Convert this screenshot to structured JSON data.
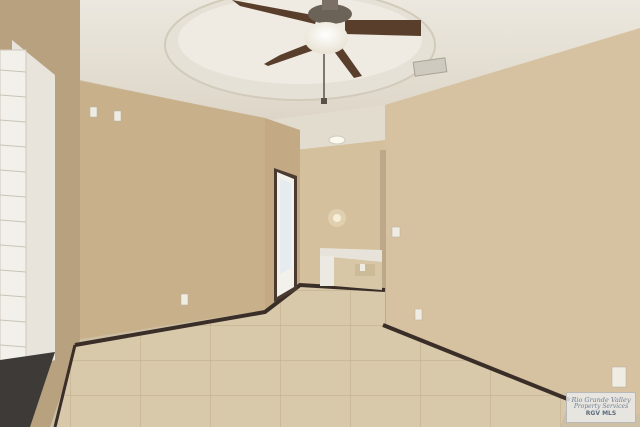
{
  "scene": {
    "description_type": "photo",
    "colors": {
      "wall_left": "#c9b18c",
      "wall_back": "#d6c3a1",
      "wall_right": "#d8c5a2",
      "ceiling": "#e9e4da",
      "floor_tile": "#d8c8aa",
      "baseboard": "#3a2e28",
      "window_sill": "#3d3a38",
      "door_frame": "#4a3a30",
      "fan_blade": "#5a3e2c"
    }
  },
  "watermark": {
    "line1": "Rio Grande Valley",
    "line2": "Property Services",
    "mls": "RGV MLS"
  }
}
